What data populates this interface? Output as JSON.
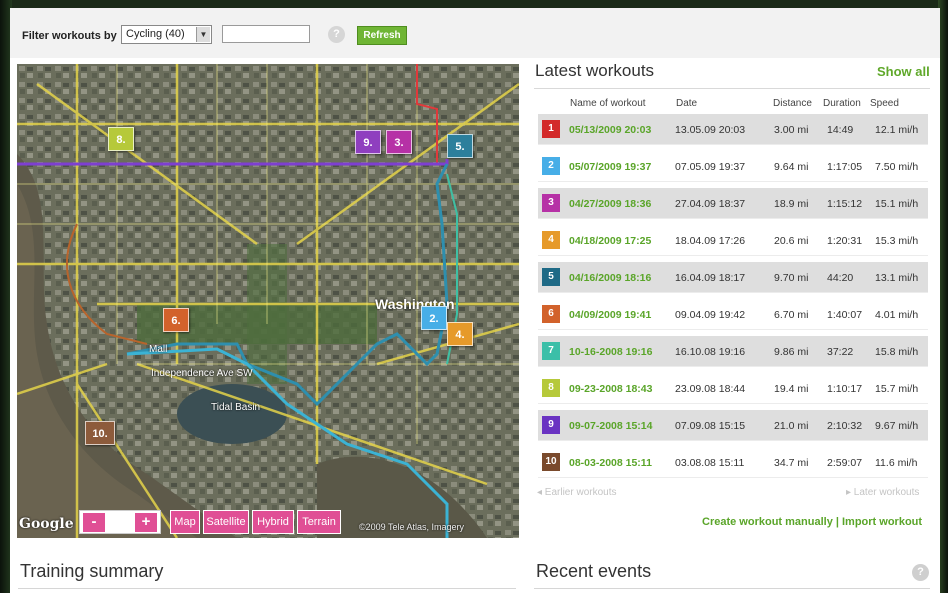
{
  "filter": {
    "label": "Filter workouts by",
    "selected": "Cycling (40)",
    "input_value": "",
    "help": "?",
    "refresh_label": "Refresh"
  },
  "map": {
    "labels": {
      "washington": "Washington",
      "tidal_basin": "Tidal Basin",
      "independence": "Independence Ave SW",
      "mall": "Mall"
    },
    "markers": [
      {
        "label": "8.",
        "color": "#b6c93a"
      },
      {
        "label": "9.",
        "color": "#8f3fbf"
      },
      {
        "label": "3.",
        "color": "#b631a6"
      },
      {
        "label": "5.",
        "color": "#2c7f9c"
      },
      {
        "label": "6.",
        "color": "#d2622b"
      },
      {
        "label": "2.",
        "color": "#47aee7"
      },
      {
        "label": "4.",
        "color": "#e69a2a"
      },
      {
        "label": "10.",
        "color": "#8d5b3b"
      }
    ],
    "controls": {
      "zoom_out": "-",
      "zoom_in": "+",
      "map": "Map",
      "satellite": "Satellite",
      "hybrid": "Hybrid",
      "terrain": "Terrain"
    },
    "google": "Google",
    "copyright": "©2009 Tele Atlas, Imagery"
  },
  "latest": {
    "title": "Latest workouts",
    "show_all": "Show all",
    "columns": {
      "name": "Name of workout",
      "date": "Date",
      "distance": "Distance",
      "duration": "Duration",
      "speed": "Speed"
    },
    "rows": [
      {
        "num": "1",
        "color": "#d32a2a",
        "name": "05/13/2009 20:03",
        "date": "13.05.09 20:03",
        "distance": "3.00 mi",
        "duration": "14:49",
        "speed": "12.1 mi/h"
      },
      {
        "num": "2",
        "color": "#47aee7",
        "name": "05/07/2009 19:37",
        "date": "07.05.09 19:37",
        "distance": "9.64 mi",
        "duration": "1:17:05",
        "speed": "7.50 mi/h"
      },
      {
        "num": "3",
        "color": "#b631a6",
        "name": "04/27/2009 18:36",
        "date": "27.04.09 18:37",
        "distance": "18.9 mi",
        "duration": "1:15:12",
        "speed": "15.1 mi/h"
      },
      {
        "num": "4",
        "color": "#e69a2a",
        "name": "04/18/2009 17:25",
        "date": "18.04.09 17:26",
        "distance": "20.6 mi",
        "duration": "1:20:31",
        "speed": "15.3 mi/h"
      },
      {
        "num": "5",
        "color": "#1f6a86",
        "name": "04/16/2009 18:16",
        "date": "16.04.09 18:17",
        "distance": "9.70 mi",
        "duration": "44:20",
        "speed": "13.1 mi/h"
      },
      {
        "num": "6",
        "color": "#d2622b",
        "name": "04/09/2009 19:41",
        "date": "09.04.09 19:42",
        "distance": "6.70 mi",
        "duration": "1:40:07",
        "speed": "4.01 mi/h"
      },
      {
        "num": "7",
        "color": "#3bbfa8",
        "name": "10-16-2008 19:16",
        "date": "16.10.08 19:16",
        "distance": "9.86 mi",
        "duration": "37:22",
        "speed": "15.8 mi/h"
      },
      {
        "num": "8",
        "color": "#b6c93a",
        "name": "09-23-2008 18:43",
        "date": "23.09.08 18:44",
        "distance": "19.4 mi",
        "duration": "1:10:17",
        "speed": "15.7 mi/h"
      },
      {
        "num": "9",
        "color": "#6a33c2",
        "name": "09-07-2008 15:14",
        "date": "07.09.08 15:15",
        "distance": "21.0 mi",
        "duration": "2:10:32",
        "speed": "9.67 mi/h"
      },
      {
        "num": "10",
        "color": "#7a4a2c",
        "name": "08-03-2008 15:11",
        "date": "03.08.08 15:11",
        "distance": "34.7 mi",
        "duration": "2:59:07",
        "speed": "11.6 mi/h"
      }
    ],
    "earlier": "◂ Earlier workouts",
    "later": "▸ Later workouts",
    "create": "Create workout manually | Import workout"
  },
  "training_summary": {
    "title": "Training summary"
  },
  "recent_events": {
    "title": "Recent events",
    "help": "?"
  }
}
